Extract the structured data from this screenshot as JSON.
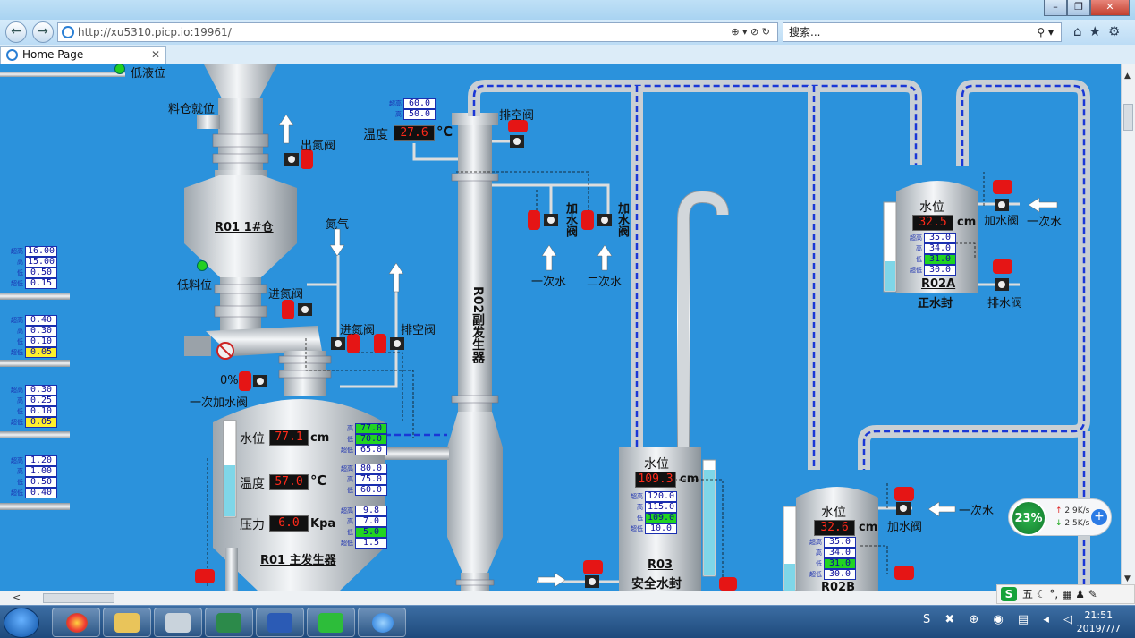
{
  "browser": {
    "url": "http://xu5310.picp.io:19961/",
    "search_placeholder": "搜索...",
    "tab_title": "Home Page",
    "window_buttons": {
      "min": "–",
      "max": "❐",
      "close": "✕"
    }
  },
  "scada": {
    "low_level": "低液位",
    "silo_level": "料仓就位",
    "nitrogen_out": "出氮阀",
    "silo": "R01  1#仓",
    "nitrogen": "氮气",
    "low_material": "低料位",
    "n2_in_1": "进氮阀",
    "n2_in_2": "进氮阀",
    "vent_1": "排空阀",
    "vent_2": "排空阀",
    "percent": "0%",
    "first_water_valve": "一次加水阀",
    "temp_label": "温度",
    "temp_top": "27.6",
    "celsius": "℃",
    "sec_water_a": "加水阀",
    "sec_water_b": "加水阀",
    "first_water": "一次水",
    "second_water": "二次水",
    "sub_gen": "R02副发生器",
    "main": {
      "water_label": "水位",
      "water": "77.1",
      "water_unit": "cm",
      "temp_label": "温度",
      "temp": "57.0",
      "temp_unit": "℃",
      "press_label": "压力",
      "press": "6.0",
      "press_unit": "Kpa",
      "name": "R01 主发生器"
    },
    "r03": {
      "water_label": "水位",
      "water": "109.3",
      "unit": "cm",
      "name1": "R03",
      "name2": "安全水封"
    },
    "r02a": {
      "water_label": "水位",
      "water": "32.5",
      "unit": "cm",
      "name1": "R02A",
      "name2": "正水封",
      "add": "加水阀",
      "drain": "排水阀",
      "first_water": "一次水"
    },
    "r02b": {
      "water_label": "水位",
      "water": "32.6",
      "unit": "cm",
      "name1": "R02B",
      "add": "加水阀",
      "first_water": "一次水"
    }
  },
  "setpoints": {
    "k4": [
      "超高",
      "高",
      "低",
      "超低"
    ],
    "left1": [
      "16.00",
      "15.00",
      "0.50",
      "0.15"
    ],
    "left2": [
      "0.40",
      "0.30",
      "0.10",
      "0.05"
    ],
    "left3": [
      "0.30",
      "0.25",
      "0.10",
      "0.05"
    ],
    "left4": [
      "1.20",
      "1.00",
      "0.50",
      "0.40"
    ],
    "top": [
      "60.0",
      "50.0"
    ],
    "main_water": [
      "77.0",
      "70.0",
      "65.0"
    ],
    "main_temp": [
      "80.0",
      "75.0",
      "60.0"
    ],
    "main_press": [
      "9.8",
      "7.0",
      "5.0",
      "1.5"
    ],
    "r03": [
      "120.0",
      "115.0",
      "109.0",
      "10.0"
    ],
    "r02a": [
      "35.0",
      "34.0",
      "31.0",
      "30.0"
    ],
    "r02b": [
      "35.0",
      "34.0",
      "31.0",
      "30.0"
    ]
  },
  "network": {
    "percent": "23%",
    "up": "2.9K/s",
    "down": "2.5K/s"
  },
  "ime": {
    "mode": "五"
  },
  "clock": {
    "time": "21:51",
    "date": "2019/7/7"
  }
}
